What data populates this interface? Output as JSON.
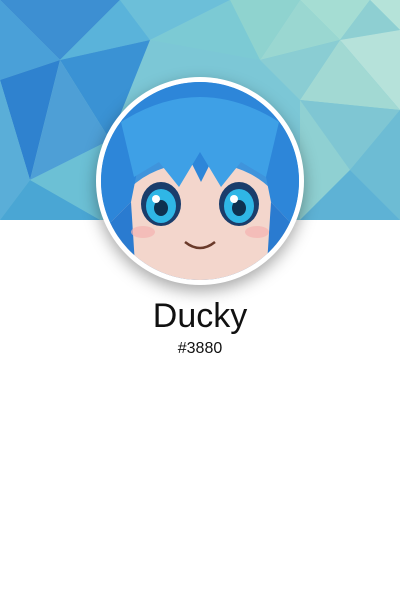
{
  "profile": {
    "username": "Ducky",
    "discriminator": "#3880"
  },
  "avatar": {
    "icon": "anime-character-avatar"
  },
  "colors": {
    "banner_light": "#8fd0cf",
    "banner_mid": "#4fb0d8",
    "banner_dark": "#2a7fd0",
    "background": "#ffffff",
    "text": "#111111"
  }
}
